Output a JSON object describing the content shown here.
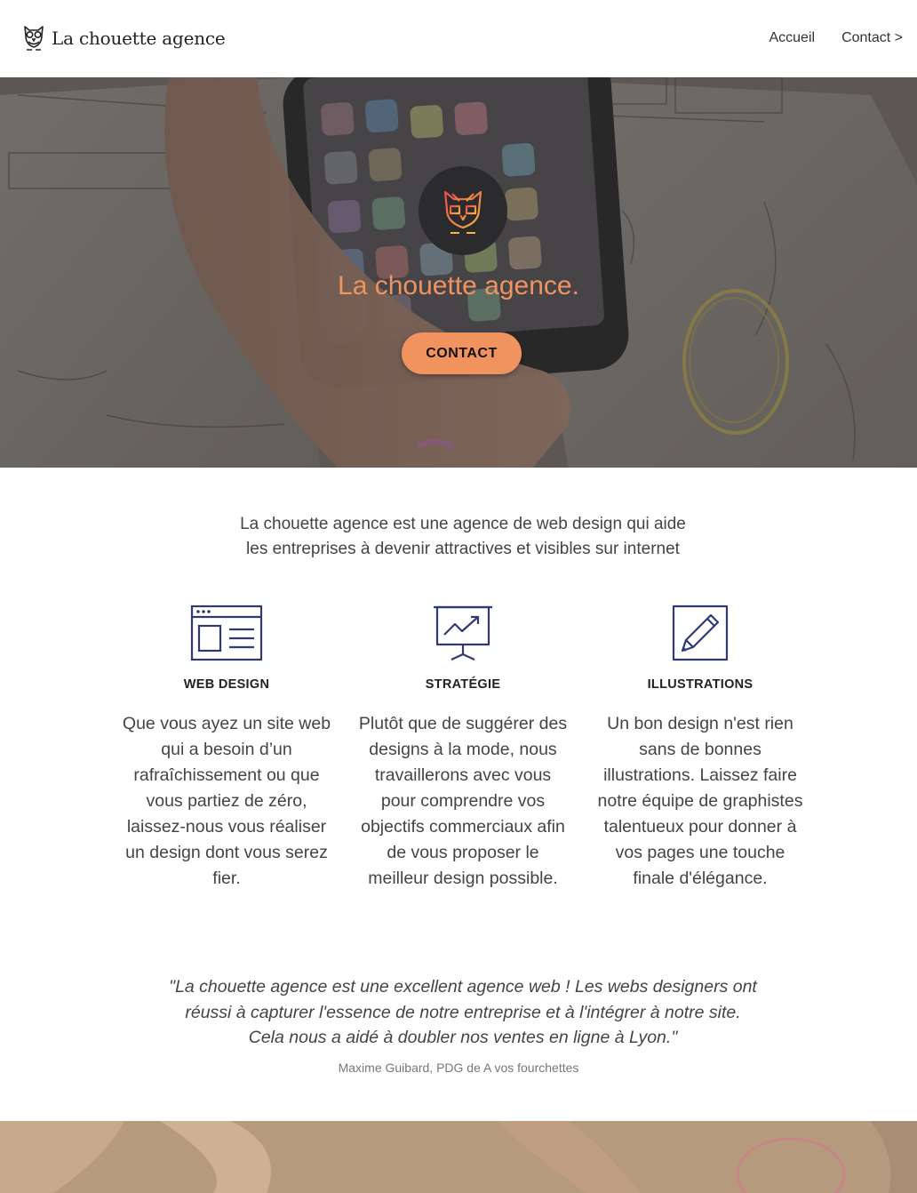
{
  "header": {
    "brand": "La chouette agence",
    "logo_icon": "owl-icon",
    "nav": [
      {
        "label": "Accueil"
      },
      {
        "label": "Contact >"
      }
    ]
  },
  "hero": {
    "title": "La chouette agence.",
    "button_label": "CONTACT",
    "badge_icon": "owl-logo-icon",
    "accent_color": "#f0935f"
  },
  "intro": {
    "text": "La chouette agence est une agence de web design qui aide les entreprises à devenir attractives et visibles sur internet"
  },
  "services": [
    {
      "icon": "web-design-icon",
      "title": "WEB DESIGN",
      "text": "Que vous ayez un site web qui a besoin d’un rafraîchissement ou que vous partiez de zéro, laissez-nous vous réaliser un design dont vous serez fier."
    },
    {
      "icon": "strategy-chart-icon",
      "title": "STRATÉGIE",
      "text": "Plutôt que de suggérer des designs à la mode, nous travaillerons avec vous pour comprendre vos objectifs commerciaux afin de vous proposer le meilleur design possible."
    },
    {
      "icon": "pencil-icon",
      "title": "ILLUSTRATIONS",
      "text": "Un bon design n'est rien sans de bonnes illustrations. Laissez faire notre équipe de graphistes talentueux pour donner à vos pages une touche finale d'élégance."
    }
  ],
  "testimonial": {
    "quote": "\"La chouette agence est une excellent agence web ! Les webs designers ont réussi à capturer l'essence de notre entreprise et à l'intégrer à notre site. Cela nous a aidé à doubler nos ventes en ligne à Lyon.\"",
    "author": "Maxime Guibard, PDG de A vos fourchettes"
  },
  "colors": {
    "accent": "#f0935f",
    "icon_stroke": "#2f3a73",
    "text": "#444444"
  }
}
